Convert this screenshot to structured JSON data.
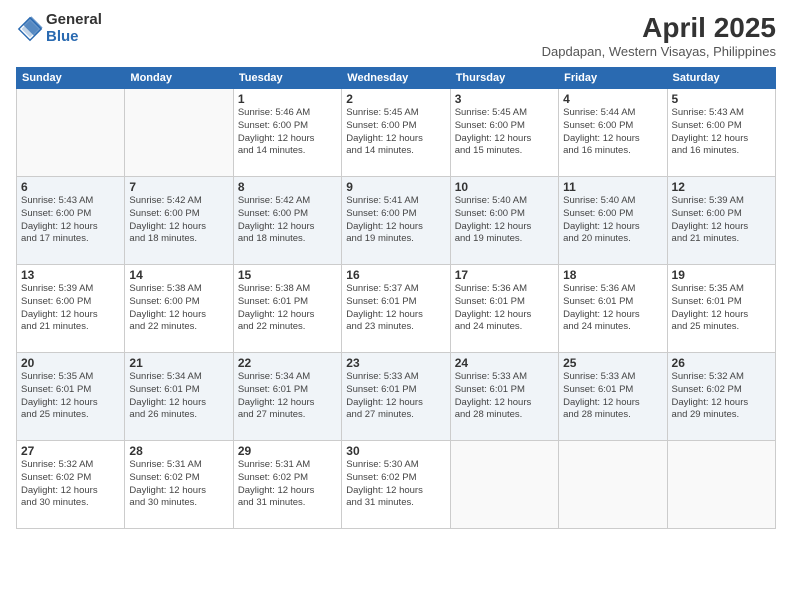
{
  "logo": {
    "general": "General",
    "blue": "Blue"
  },
  "title": "April 2025",
  "location": "Dapdapan, Western Visayas, Philippines",
  "days_header": [
    "Sunday",
    "Monday",
    "Tuesday",
    "Wednesday",
    "Thursday",
    "Friday",
    "Saturday"
  ],
  "weeks": [
    [
      {
        "num": "",
        "info": ""
      },
      {
        "num": "",
        "info": ""
      },
      {
        "num": "1",
        "info": "Sunrise: 5:46 AM\nSunset: 6:00 PM\nDaylight: 12 hours\nand 14 minutes."
      },
      {
        "num": "2",
        "info": "Sunrise: 5:45 AM\nSunset: 6:00 PM\nDaylight: 12 hours\nand 14 minutes."
      },
      {
        "num": "3",
        "info": "Sunrise: 5:45 AM\nSunset: 6:00 PM\nDaylight: 12 hours\nand 15 minutes."
      },
      {
        "num": "4",
        "info": "Sunrise: 5:44 AM\nSunset: 6:00 PM\nDaylight: 12 hours\nand 16 minutes."
      },
      {
        "num": "5",
        "info": "Sunrise: 5:43 AM\nSunset: 6:00 PM\nDaylight: 12 hours\nand 16 minutes."
      }
    ],
    [
      {
        "num": "6",
        "info": "Sunrise: 5:43 AM\nSunset: 6:00 PM\nDaylight: 12 hours\nand 17 minutes."
      },
      {
        "num": "7",
        "info": "Sunrise: 5:42 AM\nSunset: 6:00 PM\nDaylight: 12 hours\nand 18 minutes."
      },
      {
        "num": "8",
        "info": "Sunrise: 5:42 AM\nSunset: 6:00 PM\nDaylight: 12 hours\nand 18 minutes."
      },
      {
        "num": "9",
        "info": "Sunrise: 5:41 AM\nSunset: 6:00 PM\nDaylight: 12 hours\nand 19 minutes."
      },
      {
        "num": "10",
        "info": "Sunrise: 5:40 AM\nSunset: 6:00 PM\nDaylight: 12 hours\nand 19 minutes."
      },
      {
        "num": "11",
        "info": "Sunrise: 5:40 AM\nSunset: 6:00 PM\nDaylight: 12 hours\nand 20 minutes."
      },
      {
        "num": "12",
        "info": "Sunrise: 5:39 AM\nSunset: 6:00 PM\nDaylight: 12 hours\nand 21 minutes."
      }
    ],
    [
      {
        "num": "13",
        "info": "Sunrise: 5:39 AM\nSunset: 6:00 PM\nDaylight: 12 hours\nand 21 minutes."
      },
      {
        "num": "14",
        "info": "Sunrise: 5:38 AM\nSunset: 6:00 PM\nDaylight: 12 hours\nand 22 minutes."
      },
      {
        "num": "15",
        "info": "Sunrise: 5:38 AM\nSunset: 6:01 PM\nDaylight: 12 hours\nand 22 minutes."
      },
      {
        "num": "16",
        "info": "Sunrise: 5:37 AM\nSunset: 6:01 PM\nDaylight: 12 hours\nand 23 minutes."
      },
      {
        "num": "17",
        "info": "Sunrise: 5:36 AM\nSunset: 6:01 PM\nDaylight: 12 hours\nand 24 minutes."
      },
      {
        "num": "18",
        "info": "Sunrise: 5:36 AM\nSunset: 6:01 PM\nDaylight: 12 hours\nand 24 minutes."
      },
      {
        "num": "19",
        "info": "Sunrise: 5:35 AM\nSunset: 6:01 PM\nDaylight: 12 hours\nand 25 minutes."
      }
    ],
    [
      {
        "num": "20",
        "info": "Sunrise: 5:35 AM\nSunset: 6:01 PM\nDaylight: 12 hours\nand 25 minutes."
      },
      {
        "num": "21",
        "info": "Sunrise: 5:34 AM\nSunset: 6:01 PM\nDaylight: 12 hours\nand 26 minutes."
      },
      {
        "num": "22",
        "info": "Sunrise: 5:34 AM\nSunset: 6:01 PM\nDaylight: 12 hours\nand 27 minutes."
      },
      {
        "num": "23",
        "info": "Sunrise: 5:33 AM\nSunset: 6:01 PM\nDaylight: 12 hours\nand 27 minutes."
      },
      {
        "num": "24",
        "info": "Sunrise: 5:33 AM\nSunset: 6:01 PM\nDaylight: 12 hours\nand 28 minutes."
      },
      {
        "num": "25",
        "info": "Sunrise: 5:33 AM\nSunset: 6:01 PM\nDaylight: 12 hours\nand 28 minutes."
      },
      {
        "num": "26",
        "info": "Sunrise: 5:32 AM\nSunset: 6:02 PM\nDaylight: 12 hours\nand 29 minutes."
      }
    ],
    [
      {
        "num": "27",
        "info": "Sunrise: 5:32 AM\nSunset: 6:02 PM\nDaylight: 12 hours\nand 30 minutes."
      },
      {
        "num": "28",
        "info": "Sunrise: 5:31 AM\nSunset: 6:02 PM\nDaylight: 12 hours\nand 30 minutes."
      },
      {
        "num": "29",
        "info": "Sunrise: 5:31 AM\nSunset: 6:02 PM\nDaylight: 12 hours\nand 31 minutes."
      },
      {
        "num": "30",
        "info": "Sunrise: 5:30 AM\nSunset: 6:02 PM\nDaylight: 12 hours\nand 31 minutes."
      },
      {
        "num": "",
        "info": ""
      },
      {
        "num": "",
        "info": ""
      },
      {
        "num": "",
        "info": ""
      }
    ]
  ]
}
